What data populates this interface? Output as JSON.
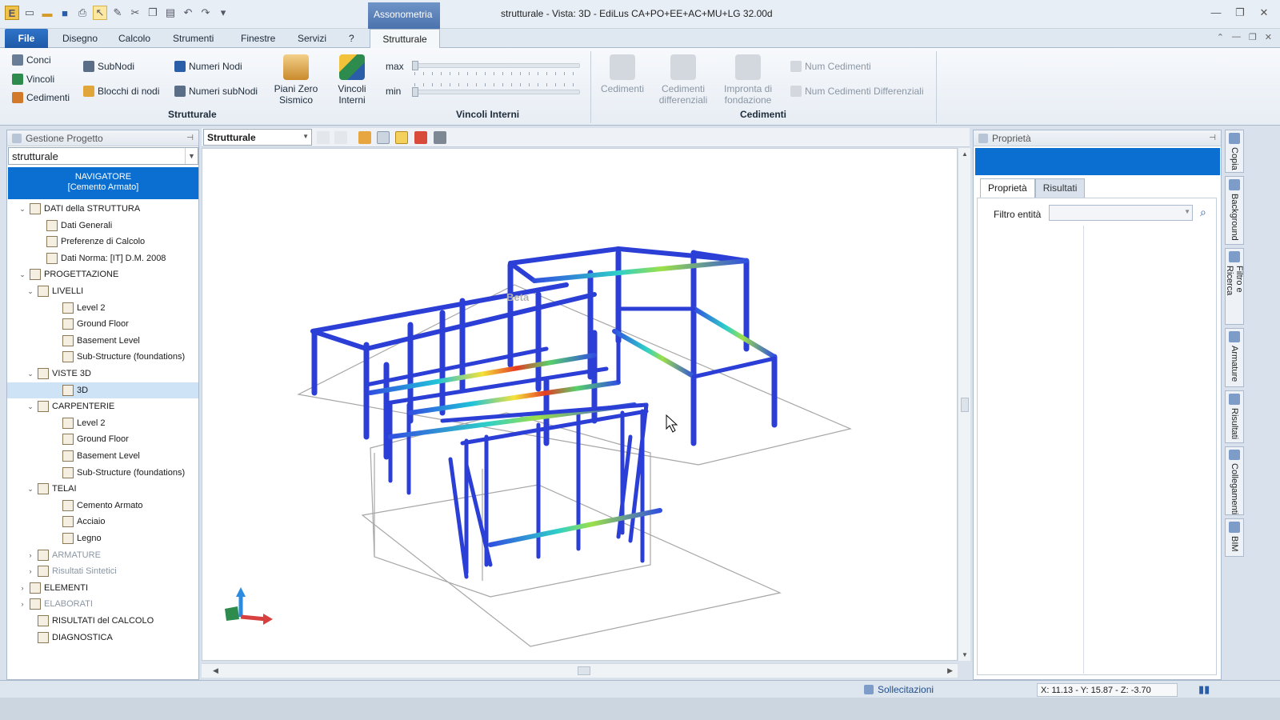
{
  "window": {
    "title": "strutturale - Vista: 3D - EdiLus CA+PO+EE+AC+MU+LG 32.00d",
    "context_tab": "Assonometria"
  },
  "menu": {
    "file": "File",
    "items": [
      "Disegno",
      "Calcolo",
      "Strumenti",
      "Finestre",
      "Servizi",
      "?"
    ],
    "active": "Strutturale"
  },
  "ribbon": {
    "strutturale": {
      "label": "Strutturale",
      "conci": "Conci",
      "vincoli": "Vincoli",
      "cedimenti": "Cedimenti",
      "subnodi": "SubNodi",
      "blocchi": "Blocchi di nodi",
      "numeri_nodi": "Numeri Nodi",
      "numeri_subnodi": "Numeri subNodi",
      "piani_zero_1": "Piani Zero",
      "piani_zero_2": "Sismico"
    },
    "vincoli_interni": {
      "label": "Vincoli Interni",
      "btn_1": "Vincoli",
      "btn_2": "Interni",
      "max": "max",
      "min": "min"
    },
    "cedimenti": {
      "label": "Cedimenti",
      "ced": "Cedimenti",
      "ced_diff_1": "Cedimenti",
      "ced_diff_2": "differenziali",
      "impronta_1": "Impronta di",
      "impronta_2": "fondazione",
      "num_ced": "Num Cedimenti",
      "num_ced_diff": "Num Cedimenti Differenziali"
    }
  },
  "left_panel": {
    "title": "Gestione Progetto",
    "combo_value": "strutturale",
    "nav_title": "NAVIGATORE",
    "nav_sub": "[Cemento Armato]",
    "tree": [
      "DATI della STRUTTURA",
      "Dati Generali",
      "Preferenze di Calcolo",
      "Dati Norma: [IT] D.M. 2008",
      "PROGETTAZIONE",
      "LIVELLI",
      "Level 2",
      "Ground Floor",
      "Basement Level",
      "Sub-Structure (foundations)",
      "VISTE 3D",
      "3D",
      "CARPENTERIE",
      "Level 2",
      "Ground Floor",
      "Basement Level",
      "Sub-Structure (foundations)",
      "TELAI",
      "Cemento Armato",
      "Acciaio",
      "Legno",
      "ARMATURE",
      "Risultati Sintetici",
      "ELEMENTI",
      "ELABORATI",
      "RISULTATI del CALCOLO",
      "DIAGNOSTICA"
    ]
  },
  "view": {
    "combo": "Strutturale",
    "watermark": "Beta"
  },
  "right_panel": {
    "title": "Proprietà",
    "tab_props": "Proprietà",
    "tab_results": "Risultati",
    "filter_label": "Filtro entità"
  },
  "side_strip": [
    "Copia",
    "Background",
    "Filtro e Ricerca",
    "Armature",
    "Risultati",
    "Collegamenti",
    "BIM"
  ],
  "status": {
    "solicitations": "Sollecitazioni",
    "coords": "X: 11.13 - Y: 15.87 - Z: -3.70"
  },
  "colors": {
    "accent": "#0a6fd0",
    "beam": "#2b3fd6",
    "file_button": "#1e5aa8"
  }
}
